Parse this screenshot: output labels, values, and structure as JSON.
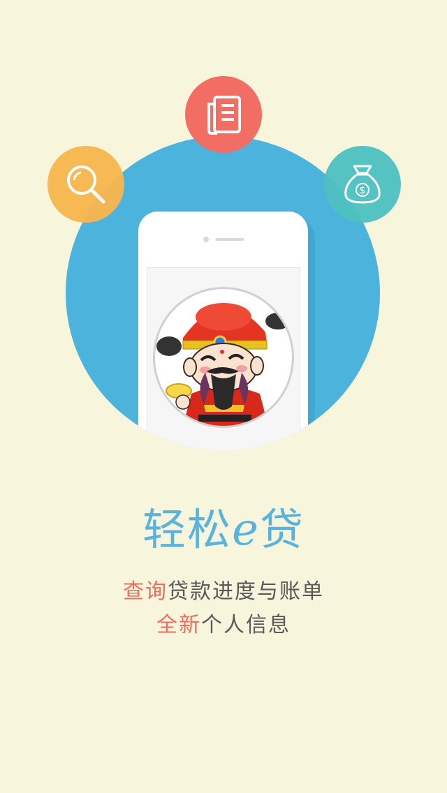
{
  "hero": {
    "title_main": "轻松",
    "title_e": "e",
    "title_tail": "贷"
  },
  "features": {
    "line1_highlight": "查询",
    "line1_rest": "贷款进度与账单",
    "line2_highlight": "全新",
    "line2_rest": "个人信息"
  },
  "icons": {
    "search": "search-icon",
    "document": "document-icon",
    "money": "money-bag-icon"
  },
  "colors": {
    "background": "#f7f5dc",
    "circle_blue": "#4cb3dc",
    "search_orange": "#f8b74e",
    "doc_red": "#f26d64",
    "money_teal": "#4fc1c0",
    "highlight": "#ef6c5e",
    "title_blue": "#5ab3dd"
  }
}
